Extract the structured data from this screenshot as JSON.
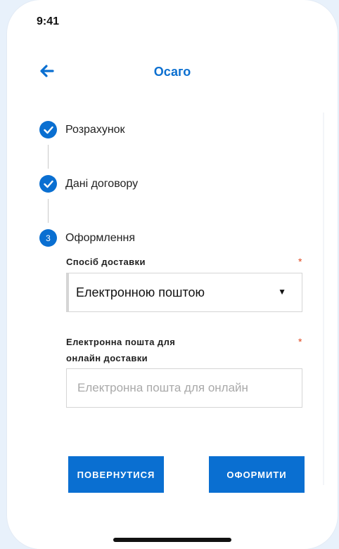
{
  "status_bar": {
    "time": "9:41"
  },
  "header": {
    "title": "Осаго"
  },
  "steps": [
    {
      "label": "Розрахунок",
      "state": "done"
    },
    {
      "label": "Дані договору",
      "state": "done"
    },
    {
      "label": "Оформлення",
      "state": "active",
      "number": "3"
    }
  ],
  "form": {
    "delivery": {
      "label": "Спосіб доставки",
      "required_mark": "*",
      "value": "Електронною поштою",
      "arrow": "▼"
    },
    "email": {
      "label_line1": "Електронна пошта для",
      "label_line2": "онлайн доставки",
      "required_mark": "*",
      "placeholder": "Електронна пошта для онлайн"
    }
  },
  "buttons": {
    "back": "ПОВЕРНУТИСЯ",
    "submit": "ОФОРМИТИ"
  },
  "colors": {
    "accent": "#0a6fd1",
    "required": "#e0481f"
  }
}
